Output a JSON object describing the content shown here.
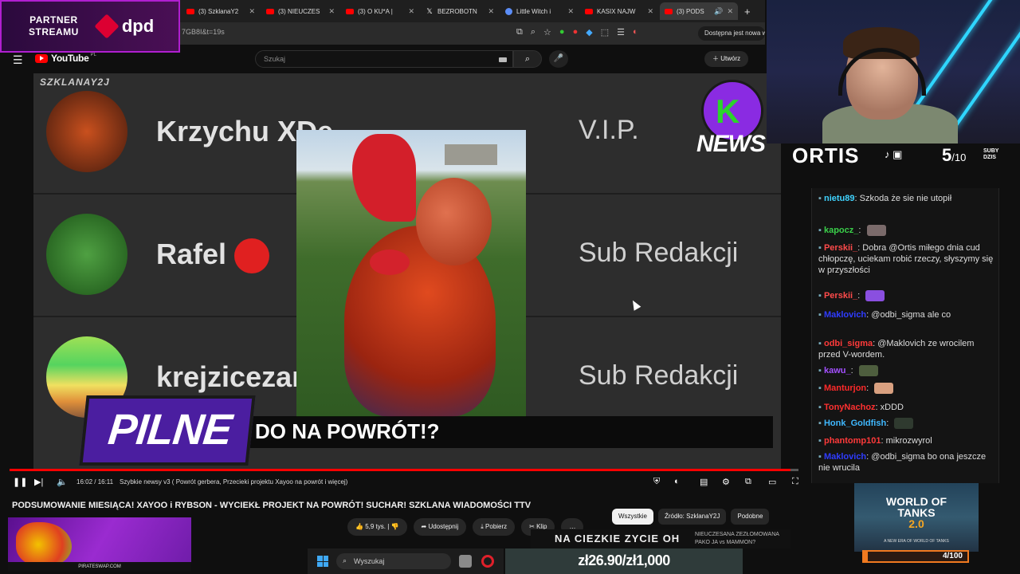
{
  "partner": {
    "line1": "PARTNER",
    "line2": "STREAMU",
    "brand": "dpd"
  },
  "tabs": [
    {
      "label": "(3) SzklanaY2"
    },
    {
      "label": "(3) NIEUCZES"
    },
    {
      "label": "(3) O KU*A |"
    },
    {
      "label": "BEZROBOTN"
    },
    {
      "label": "Little Witch i"
    },
    {
      "label": "KASIX NAJW"
    },
    {
      "label": "(3) PODS"
    }
  ],
  "address": {
    "url": "7GB8I&t=19s",
    "update_label": "Dostępna jest nowa w"
  },
  "youtube": {
    "logo": "YouTube",
    "region": "PL",
    "search_placeholder": "Szukaj",
    "create_label": "Utwórz"
  },
  "video": {
    "brand": "SZKLANAY2J",
    "rows": [
      {
        "name": "Krzychu XDe",
        "role": "V.I.P."
      },
      {
        "name": "Rafel",
        "role": "Sub Redakcji"
      },
      {
        "name": "krejzicezar",
        "role": "Sub Redakcji"
      }
    ],
    "caption": "DO NA POWRÓT!?",
    "pilne": "PILNE",
    "news_letter": "K",
    "news_word": "NEWS"
  },
  "player": {
    "time": "16:02 / 16:11",
    "chapter": "Szybkie newsy v3 ( Powrót gerbera, Przecieki projektu Xayoo na powrót i więcej)",
    "progress_fraction": 0.99
  },
  "watch": {
    "title": "PODSUMOWANIE MIESIĄCA! XAYOO i RYBSON - WYCIEKŁ PROJEKT NA POWRÓT! SUCHAR! SZKLANA WIADOMOŚCI TTV",
    "likes": "5,9 tys.",
    "share": "Udostępnij",
    "download": "Pobierz",
    "clip": "Klip",
    "more": "…",
    "chips": [
      "Wszystkie",
      "Źródło: SzklanaY2J",
      "Podobne"
    ],
    "ad_footer": "PIRATESWAP.COM"
  },
  "ticker": {
    "main": "NA CIEZKIE ZYCIE OH",
    "side1": "NIEUCZESANA ZEZŁOMOWANA",
    "side2": "PAKO JA vs MAMMON?"
  },
  "taskbar": {
    "search": "Wyszukaj",
    "price": "zł26.90/zł1,000"
  },
  "streamer": {
    "name": "ORTIS",
    "subs_count": "5",
    "subs_total": "/10",
    "subs_label1": "SUBY",
    "subs_label2": "DZIS"
  },
  "chat": [
    {
      "user": "nietu89",
      "color": "#3fd3ff",
      "text": "Szkoda że sie nie utopił"
    },
    {
      "user": "kapocz_",
      "color": "#3ad04a",
      "text": ""
    },
    {
      "user": "Perskii_",
      "color": "#ff4b4b",
      "text": "Dobra @Ortis miłego dnia cud chłopczę, uciekam robić rzeczy, słyszymy się w przyszłości"
    },
    {
      "user": "Perskii_",
      "color": "#ff4b4b",
      "text": ""
    },
    {
      "user": "Maklovich",
      "color": "#2f3cff",
      "text": "@odbi_sigma ale co"
    },
    {
      "user": "odbi_sigma",
      "color": "#ff3a3a",
      "text": "@Maklovich ze wrocilem przed V-wordem."
    },
    {
      "user": "kawu_",
      "color": "#a350ff",
      "text": ""
    },
    {
      "user": "Manturjon",
      "color": "#ff2a2a",
      "text": ""
    },
    {
      "user": "TonyNachoz",
      "color": "#ff3030",
      "text": "xDDD"
    },
    {
      "user": "Honk_Goldfish",
      "color": "#3fb8ff",
      "text": ""
    },
    {
      "user": "phantomp101",
      "color": "#ff3a3a",
      "text": "mikrozwyrol"
    },
    {
      "user": "Maklovich",
      "color": "#2f3cff",
      "text": "@odbi_sigma bo ona jeszcze nie wrucila"
    }
  ],
  "wot": {
    "title": "WORLD OF TANKS",
    "version": "2.0",
    "tagline": "A NEW ERA OF WORLD OF TANKS"
  },
  "goal": {
    "label": "4/100",
    "fraction": 0.04
  }
}
